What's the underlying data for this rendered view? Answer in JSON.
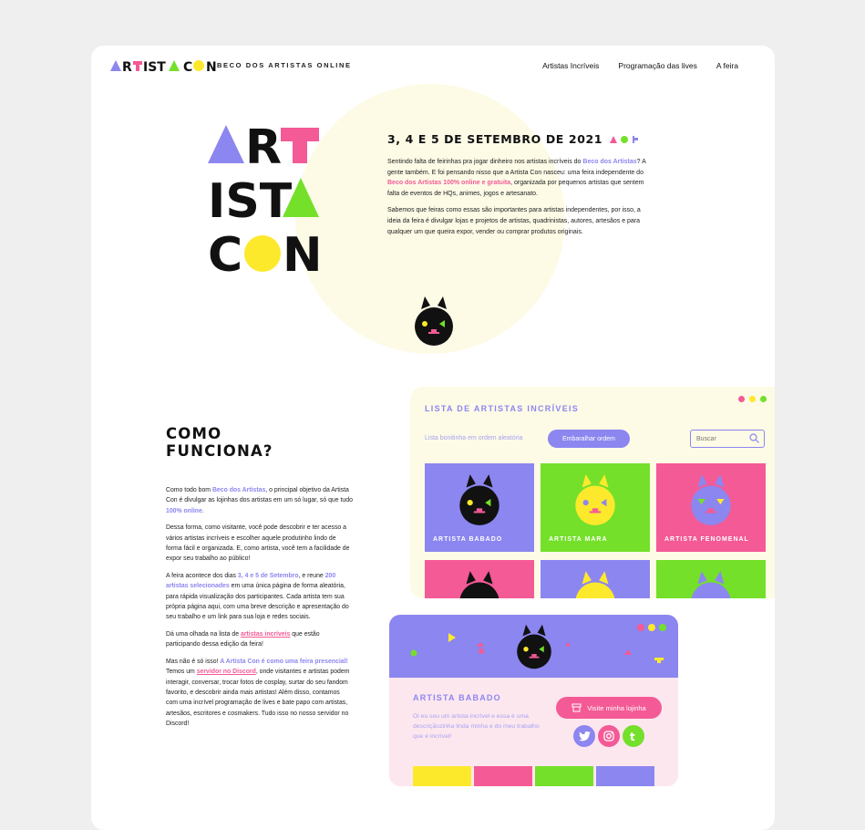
{
  "header": {
    "logo_text": "ARTISTA CON",
    "tagline": "BECO DOS ARTISTAS ONLINE",
    "nav": [
      "Artistas Incríveis",
      "Programação das lives",
      "A feira"
    ]
  },
  "hero": {
    "big_logo": [
      "ART",
      "ISTA",
      "CON"
    ],
    "date": "3, 4 E 5 DE SETEMBRO DE 2021",
    "p1_a": "Sentindo falta de feirinhas pra jogar dinheiro nos artistas incríveis do ",
    "p1_link1": "Beco dos Artistas",
    "p1_b": "? A gente também. E foi pensando nisso que a Artista Con nasceu: uma feira independente do ",
    "p1_link2": "Beco dos Artistas 100% online e gratuita",
    "p1_c": ", organizada por pequenos artistas que sentem falta de eventos de HQs, animes, jogos e artesanato.",
    "p2": "Sabemos que feiras como essas são importantes para artistas independentes, por isso, a ideia da feira é divulgar lojas e projetos de artistas, quadrinistas, autores, artesãos e para qualquer um que queira expor, vender ou comprar produtos originais."
  },
  "how": {
    "title_l1": "COMO",
    "title_l2": "FUNCIONA?",
    "p1_a": "Como todo bom ",
    "p1_link": "Beco dos Artistas",
    "p1_b": ", o principal objetivo da Artista Con é divulgar as lojinhas dos artistas em um só lugar, só que tudo ",
    "p1_hl": "100% online",
    "p1_c": ".",
    "p2": "Dessa forma, como visitante, você pode descobrir e ter acesso a vários artistas incríveis e escolher aquele produtinho lindo de forma fácil e organizada. E, como artista, você tem a facilidade de expor seu trabalho ao público!",
    "p3_a": "A feira acontece dos dias ",
    "p3_hl1": "3, 4 e 5 de Setembro",
    "p3_b": ", e reune ",
    "p3_hl2": "200 artistas selecionades",
    "p3_c": " em uma única página de forma aleatória, para rápida visualização dos participantes. Cada artista tem sua própria página aqui, com uma breve descrição e apresentação do seu trabalho e um link para sua loja e redes sociais.",
    "p4_a": "Dá uma olhada na lista de ",
    "p4_link": "artistas incríveis",
    "p4_b": " que estão participando dessa edição da feira!",
    "p5_a": "Mas não é só isso! ",
    "p5_hl": "A Artista Con é como uma feira presencial!",
    "p5_b": " Temos um ",
    "p5_link": "servidor no Discord",
    "p5_c": ", onde visitantes e artistas podem interagir, conversar, trocar fotos de cosplay, surtar do seu fandom favorito, e descobrir ainda mais artistas! Além disso, contamos com uma incrível programação de lives e bate papo com artistas, artesãos, escritores e cosmakers. Tudo isso no nosso servidor no Discord!"
  },
  "list": {
    "title": "LISTA DE ARTISTAS INCRÍVEIS",
    "subtitle": "Lista bonitinha em ordem aleatória",
    "shuffle_label": "Embaralhar ordem",
    "search_placeholder": "Buscar",
    "cards": [
      {
        "label": "ARTISTA BABADO",
        "bg": "#8c86f0"
      },
      {
        "label": "ARTISTA MARA",
        "bg": "#74e02a"
      },
      {
        "label": "ARTISTA FENOMENAL",
        "bg": "#f45a96"
      }
    ]
  },
  "profile": {
    "name": "ARTISTA BABADO",
    "description": "Oi eu sou um artista incrível e essa é uma descriçãozinha linda minha e do meu trabalho que é incrível!",
    "visit_label": "Visite minha lojinha",
    "social": [
      "twitter",
      "instagram",
      "tumblr"
    ]
  },
  "colors": {
    "purple": "#8c86f0",
    "pink": "#f45a96",
    "green": "#74e02a",
    "yellow": "#fde92c",
    "cream": "#fdfbe6"
  }
}
